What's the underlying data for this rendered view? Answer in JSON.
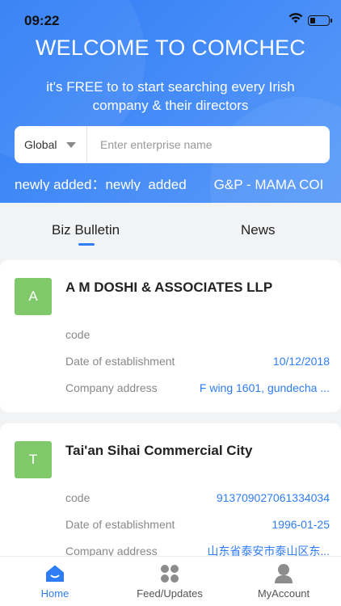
{
  "status": {
    "time": "09:22"
  },
  "hero": {
    "title": "WELCOME TO COMCHEC",
    "subtitle": "it's FREE to to start searching every Irish company & their directors"
  },
  "search": {
    "scope": "Global",
    "placeholder": "Enter enterprise name"
  },
  "ticker": {
    "label": "newly added：newly_added",
    "item": "G&P - MAMA COI"
  },
  "tabs": {
    "biz": "Biz Bulletin",
    "news": "News"
  },
  "cards": [
    {
      "initial": "A",
      "name": "A M DOSHI & ASSOCIATES LLP",
      "fields": [
        {
          "label": "code",
          "value": ""
        },
        {
          "label": "Date of establishment",
          "value": "10/12/2018"
        },
        {
          "label": "Company address",
          "value": "F wing 1601, gundecha ..."
        }
      ]
    },
    {
      "initial": "T",
      "name": "Tai'an Sihai Commercial City",
      "fields": [
        {
          "label": "code",
          "value": "913709027061334034"
        },
        {
          "label": "Date of establishment",
          "value": "1996-01-25"
        },
        {
          "label": "Company address",
          "value": "山东省泰安市泰山区东..."
        }
      ]
    }
  ],
  "tabbar": {
    "home": "Home",
    "feed": "Feed/Updates",
    "account": "MyAccount"
  },
  "colors": {
    "accent": "#2f7df6",
    "avatar": "#7fc96a"
  }
}
